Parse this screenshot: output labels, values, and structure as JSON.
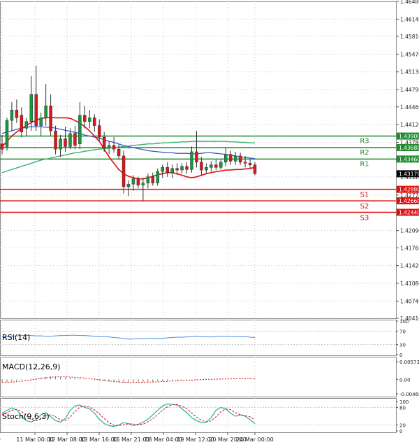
{
  "main": {
    "y_ticks": [
      "1.46480",
      "1.46140",
      "1.45810",
      "1.45470",
      "1.45130",
      "1.44790",
      "1.44460",
      "1.44120",
      "1.43780",
      "1.43460",
      "1.43120",
      "1.42770",
      "1.42430",
      "1.42090",
      "1.41760",
      "1.41420",
      "1.41080",
      "1.40740",
      "1.40410"
    ],
    "x_ticks": [
      "11 Mar 00:00",
      "12 Mar 08:00",
      "13 Mar 16:00",
      "16 Mar 21:01",
      "18 Mar 04:00",
      "19 Mar 12:00",
      "20 Mar 20:00",
      "24 Mar 00:00"
    ],
    "current_price": "1.43179",
    "levels": [
      {
        "name": "R3",
        "price": "1.43900",
        "color": "#1f8a2e"
      },
      {
        "name": "R2",
        "price": "1.43680",
        "color": "#1f8a2e"
      },
      {
        "name": "R1",
        "price": "1.43460",
        "color": "#1f8a2e"
      },
      {
        "name": "S1",
        "price": "1.42880",
        "color": "#e01010"
      },
      {
        "name": "S2",
        "price": "1.42660",
        "color": "#e01010"
      },
      {
        "name": "S3",
        "price": "1.42440",
        "color": "#e01010"
      }
    ]
  },
  "rsi": {
    "label": "RSI(14)",
    "y_ticks": [
      "100",
      "70",
      "30",
      "0"
    ]
  },
  "macd": {
    "label": "MACD(12,26,9)",
    "y_ticks": [
      "0.005733",
      "0.00",
      "-0.00468"
    ]
  },
  "stoch": {
    "label": "Stoch(9,6,3)",
    "y_ticks": [
      "100",
      "80",
      "20",
      "0"
    ]
  },
  "colors": {
    "bull": "#1a9641",
    "bear": "#d7191c",
    "sma_fast": "#e01010",
    "sma_mid": "#3a5bd0",
    "sma_slow": "#3cb371",
    "rsi": "#4a90e2",
    "macd": "#e01010",
    "stoch_k": "#20b2aa",
    "stoch_d": "#e01010"
  },
  "chart_data": {
    "type": "candlestick",
    "candles": [
      {
        "o": 1.4375,
        "h": 1.4392,
        "l": 1.4355,
        "c": 1.4365
      },
      {
        "o": 1.437,
        "h": 1.4425,
        "l": 1.4362,
        "c": 1.442
      },
      {
        "o": 1.442,
        "h": 1.4455,
        "l": 1.44,
        "c": 1.444
      },
      {
        "o": 1.444,
        "h": 1.446,
        "l": 1.4415,
        "c": 1.4425
      },
      {
        "o": 1.443,
        "h": 1.4445,
        "l": 1.4388,
        "c": 1.4398
      },
      {
        "o": 1.4405,
        "h": 1.4425,
        "l": 1.439,
        "c": 1.4418
      },
      {
        "o": 1.4418,
        "h": 1.4505,
        "l": 1.44,
        "c": 1.447
      },
      {
        "o": 1.447,
        "h": 1.4525,
        "l": 1.44,
        "c": 1.441
      },
      {
        "o": 1.441,
        "h": 1.4435,
        "l": 1.439,
        "c": 1.4425
      },
      {
        "o": 1.4425,
        "h": 1.449,
        "l": 1.441,
        "c": 1.4448
      },
      {
        "o": 1.4448,
        "h": 1.447,
        "l": 1.439,
        "c": 1.44
      },
      {
        "o": 1.44,
        "h": 1.441,
        "l": 1.4355,
        "c": 1.4365
      },
      {
        "o": 1.4365,
        "h": 1.4392,
        "l": 1.435,
        "c": 1.4385
      },
      {
        "o": 1.4385,
        "h": 1.4408,
        "l": 1.436,
        "c": 1.437
      },
      {
        "o": 1.437,
        "h": 1.4405,
        "l": 1.4365,
        "c": 1.4395
      },
      {
        "o": 1.4395,
        "h": 1.441,
        "l": 1.4365,
        "c": 1.4372
      },
      {
        "o": 1.4375,
        "h": 1.4455,
        "l": 1.4365,
        "c": 1.443
      },
      {
        "o": 1.443,
        "h": 1.4448,
        "l": 1.4405,
        "c": 1.4418
      },
      {
        "o": 1.4418,
        "h": 1.444,
        "l": 1.4405,
        "c": 1.4425
      },
      {
        "o": 1.4425,
        "h": 1.4432,
        "l": 1.4398,
        "c": 1.441
      },
      {
        "o": 1.441,
        "h": 1.4422,
        "l": 1.438,
        "c": 1.4388
      },
      {
        "o": 1.4388,
        "h": 1.4398,
        "l": 1.436,
        "c": 1.4368
      },
      {
        "o": 1.4368,
        "h": 1.438,
        "l": 1.4355,
        "c": 1.4372
      },
      {
        "o": 1.4372,
        "h": 1.4388,
        "l": 1.4358,
        "c": 1.4365
      },
      {
        "o": 1.4365,
        "h": 1.4375,
        "l": 1.4345,
        "c": 1.4352
      },
      {
        "o": 1.4352,
        "h": 1.4362,
        "l": 1.428,
        "c": 1.4293
      },
      {
        "o": 1.4293,
        "h": 1.4305,
        "l": 1.4275,
        "c": 1.4298
      },
      {
        "o": 1.4298,
        "h": 1.4315,
        "l": 1.4285,
        "c": 1.4308
      },
      {
        "o": 1.4308,
        "h": 1.4312,
        "l": 1.429,
        "c": 1.4296
      },
      {
        "o": 1.4296,
        "h": 1.431,
        "l": 1.4265,
        "c": 1.43
      },
      {
        "o": 1.43,
        "h": 1.4318,
        "l": 1.429,
        "c": 1.4312
      },
      {
        "o": 1.4312,
        "h": 1.432,
        "l": 1.4295,
        "c": 1.43
      },
      {
        "o": 1.43,
        "h": 1.4328,
        "l": 1.4295,
        "c": 1.4322
      },
      {
        "o": 1.4322,
        "h": 1.4335,
        "l": 1.431,
        "c": 1.433
      },
      {
        "o": 1.433,
        "h": 1.434,
        "l": 1.4312,
        "c": 1.432
      },
      {
        "o": 1.432,
        "h": 1.4335,
        "l": 1.431,
        "c": 1.4328
      },
      {
        "o": 1.4328,
        "h": 1.4338,
        "l": 1.4315,
        "c": 1.4325
      },
      {
        "o": 1.4325,
        "h": 1.4338,
        "l": 1.4318,
        "c": 1.4332
      },
      {
        "o": 1.4332,
        "h": 1.434,
        "l": 1.4318,
        "c": 1.4326
      },
      {
        "o": 1.4326,
        "h": 1.437,
        "l": 1.432,
        "c": 1.436
      },
      {
        "o": 1.436,
        "h": 1.44,
        "l": 1.433,
        "c": 1.434
      },
      {
        "o": 1.434,
        "h": 1.435,
        "l": 1.4315,
        "c": 1.4325
      },
      {
        "o": 1.4325,
        "h": 1.4338,
        "l": 1.4318,
        "c": 1.433
      },
      {
        "o": 1.433,
        "h": 1.4342,
        "l": 1.4322,
        "c": 1.4335
      },
      {
        "o": 1.4335,
        "h": 1.4345,
        "l": 1.4325,
        "c": 1.433
      },
      {
        "o": 1.433,
        "h": 1.4345,
        "l": 1.4325,
        "c": 1.434
      },
      {
        "o": 1.434,
        "h": 1.4368,
        "l": 1.4332,
        "c": 1.4355
      },
      {
        "o": 1.4355,
        "h": 1.4362,
        "l": 1.4335,
        "c": 1.4342
      },
      {
        "o": 1.4342,
        "h": 1.436,
        "l": 1.4335,
        "c": 1.4352
      },
      {
        "o": 1.4352,
        "h": 1.4358,
        "l": 1.4335,
        "c": 1.434
      },
      {
        "o": 1.434,
        "h": 1.4352,
        "l": 1.433,
        "c": 1.4338
      },
      {
        "o": 1.4338,
        "h": 1.4345,
        "l": 1.4328,
        "c": 1.4335
      },
      {
        "o": 1.4335,
        "h": 1.434,
        "l": 1.4315,
        "c": 1.4318
      }
    ],
    "sma_fast": [
      1.437,
      1.438,
      1.439,
      1.4398,
      1.4404,
      1.441,
      1.4416,
      1.442,
      1.4424,
      1.4425,
      1.4426,
      1.4425,
      1.4425,
      1.4425,
      1.4424,
      1.442,
      1.4415,
      1.4408,
      1.44,
      1.439,
      1.438,
      1.4365,
      1.435,
      1.4338,
      1.4326,
      1.4318,
      1.4313,
      1.431,
      1.4308,
      1.4308,
      1.431,
      1.4313,
      1.4316,
      1.4318,
      1.432,
      1.432,
      1.4318,
      1.4315,
      1.4312,
      1.431,
      1.4312,
      1.4315,
      1.4318,
      1.432,
      1.4322,
      1.4323,
      1.4325,
      1.4325,
      1.4326,
      1.4326,
      1.4327,
      1.4328,
      1.433
    ],
    "sma_mid": [
      1.4395,
      1.4398,
      1.44,
      1.4403,
      1.4405,
      1.4407,
      1.4408,
      1.4408,
      1.4408,
      1.4407,
      1.4407,
      1.4405,
      1.4403,
      1.4401,
      1.4399,
      1.4397,
      1.4395,
      1.4392,
      1.439,
      1.4388,
      1.4386,
      1.4383,
      1.438,
      1.4378,
      1.4375,
      1.4372,
      1.437,
      1.4368,
      1.4366,
      1.4364,
      1.4362,
      1.4361,
      1.436,
      1.4359,
      1.4358,
      1.4358,
      1.4357,
      1.4357,
      1.4357,
      1.4356,
      1.4356,
      1.4357,
      1.4358,
      1.4358,
      1.4357,
      1.4356,
      1.4355,
      1.4353,
      1.4352,
      1.435,
      1.4349,
      1.4348,
      1.4347
    ],
    "sma_slow": [
      1.432,
      1.4323,
      1.4326,
      1.4329,
      1.4332,
      1.4335,
      1.4338,
      1.4341,
      1.4344,
      1.4346,
      1.4348,
      1.435,
      1.4352,
      1.4354,
      1.4356,
      1.4358,
      1.4359,
      1.4361,
      1.4362,
      1.4364,
      1.4365,
      1.4366,
      1.4367,
      1.4368,
      1.4369,
      1.437,
      1.4371,
      1.4372,
      1.4373,
      1.4374,
      1.4375,
      1.4375,
      1.4376,
      1.4377,
      1.4377,
      1.4378,
      1.4378,
      1.4379,
      1.4379,
      1.438,
      1.438,
      1.438,
      1.438,
      1.438,
      1.438,
      1.438,
      1.438,
      1.4379,
      1.4379,
      1.4378,
      1.4378,
      1.4377,
      1.4377
    ],
    "rsi": [
      54,
      53,
      55,
      56,
      57,
      58,
      57,
      56,
      56,
      55,
      55,
      56,
      57,
      57,
      58,
      58,
      57,
      57,
      56,
      55,
      54,
      54,
      53,
      51,
      50,
      48,
      46,
      47,
      48,
      47,
      48,
      49,
      48,
      49,
      50,
      51,
      52,
      52,
      53,
      54,
      55,
      54,
      53,
      53,
      54,
      55,
      55,
      54,
      54,
      53,
      54,
      52,
      51
    ],
    "macd": [
      -0.001,
      -0.0009,
      -0.0007,
      -0.0005,
      -0.0003,
      -0.0001,
      0.0002,
      0.0004,
      0.0006,
      0.0008,
      0.0009,
      0.0009,
      0.0008,
      0.0007,
      0.0006,
      0.0005,
      0.0004,
      0.0002,
      0.0,
      -0.0002,
      -0.0004,
      -0.0006,
      -0.0008,
      -0.0009,
      -0.001,
      -0.001,
      -0.001,
      -0.001,
      -0.0009,
      -0.0009,
      -0.0008,
      -0.0008,
      -0.0007,
      -0.0006,
      -0.0005,
      -0.0004,
      -0.0004,
      -0.0003,
      -0.0002,
      -0.0001,
      -0.0001,
      0.0,
      0.0001,
      0.0001,
      0.0001,
      0.0002,
      0.0002,
      0.0002,
      0.0002,
      0.0003,
      0.0003,
      0.0003,
      0.0003
    ],
    "stoch_k": [
      60,
      70,
      78,
      72,
      50,
      35,
      30,
      38,
      55,
      62,
      48,
      35,
      30,
      42,
      70,
      85,
      88,
      80,
      75,
      60,
      40,
      25,
      18,
      15,
      20,
      28,
      25,
      18,
      22,
      30,
      40,
      55,
      70,
      85,
      92,
      90,
      88,
      75,
      62,
      45,
      35,
      28,
      30,
      45,
      70,
      80,
      75,
      60,
      50,
      55,
      50,
      38,
      25
    ],
    "stoch_d": [
      55,
      62,
      70,
      73,
      66,
      52,
      38,
      34,
      41,
      52,
      55,
      48,
      38,
      36,
      47,
      66,
      81,
      84,
      81,
      72,
      58,
      42,
      28,
      19,
      18,
      21,
      24,
      23,
      22,
      23,
      31,
      42,
      55,
      70,
      82,
      89,
      90,
      84,
      75,
      61,
      47,
      36,
      31,
      34,
      48,
      65,
      75,
      72,
      62,
      55,
      52,
      48,
      38
    ]
  }
}
